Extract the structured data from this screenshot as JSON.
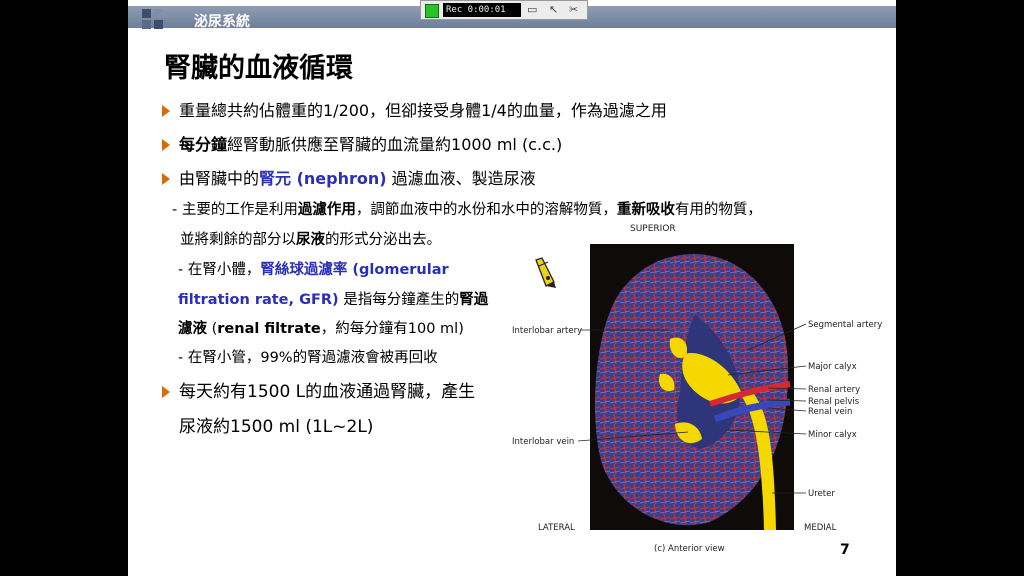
{
  "header": {
    "title": "泌尿系統"
  },
  "recorder": {
    "time": "Rec 0:00:01"
  },
  "title": "腎臟的血液循環",
  "bullets": {
    "b1": "重量總共約佔體重的1/200，但卻接受身體1/4的血量，作為過濾之用",
    "b2_bold": "每分鐘",
    "b2_rest": "經腎動脈供應至腎臟的血流量約1000 ml (c.c.)",
    "b3_pre": "由腎臟中的",
    "b3_blue": "腎元 (nephron)",
    "b3_post": " 過濾血液、製造尿液",
    "s1_pre": "- 主要的工作是利用",
    "s1_b1": "過濾作用",
    "s1_mid": "，調節血液中的水份和水中的溶解物質，",
    "s1_b2": "重新吸收",
    "s1_post": "有用的物質，",
    "s1_l2_pre": "並將剩餘的部分以",
    "s1_l2_b": "尿液",
    "s1_l2_post": "的形式分泌出去。",
    "s2_pre": "- 在腎小體，",
    "s2_blue1": "腎絲球過濾率 (glomerular",
    "s2_blue2": "filtration rate, GFR)",
    "s2_mid": " 是指每分鐘產生的",
    "s2_b": "腎過",
    "s2_l3_b1": "濾液",
    "s2_l3_mid": " (",
    "s2_l3_b2": "renal filtrate",
    "s2_l3_post": "，約每分鐘有100 ml)",
    "s3": "- 在腎小管，99%的腎過濾液會被再回收",
    "b4_l1": "每天約有1500 L的血液通過腎臟，產生",
    "b4_l2": "尿液約1500 ml (1L~2L)"
  },
  "figure": {
    "superior": "SUPERIOR",
    "lateral": "LATERAL",
    "medial": "MEDIAL",
    "caption": "(c) Anterior view",
    "labels": {
      "interlobar_artery": "Interlobar artery",
      "interlobar_vein": "Interlobar vein",
      "segmental_artery": "Segmental artery",
      "major_calyx": "Major calyx",
      "renal_artery": "Renal artery",
      "renal_pelvis": "Renal pelvis",
      "renal_vein": "Renal vein",
      "minor_calyx": "Minor calyx",
      "ureter": "Ureter"
    }
  },
  "page_number": "7",
  "colors": {
    "bullet": "#d76b00",
    "highlight_blue": "#2a2fb8",
    "header_bar": "#7a89a3"
  },
  "icons": {
    "bullet": "orange-triangle-bullet-icon",
    "cursor": "highlighter-cursor-icon"
  }
}
